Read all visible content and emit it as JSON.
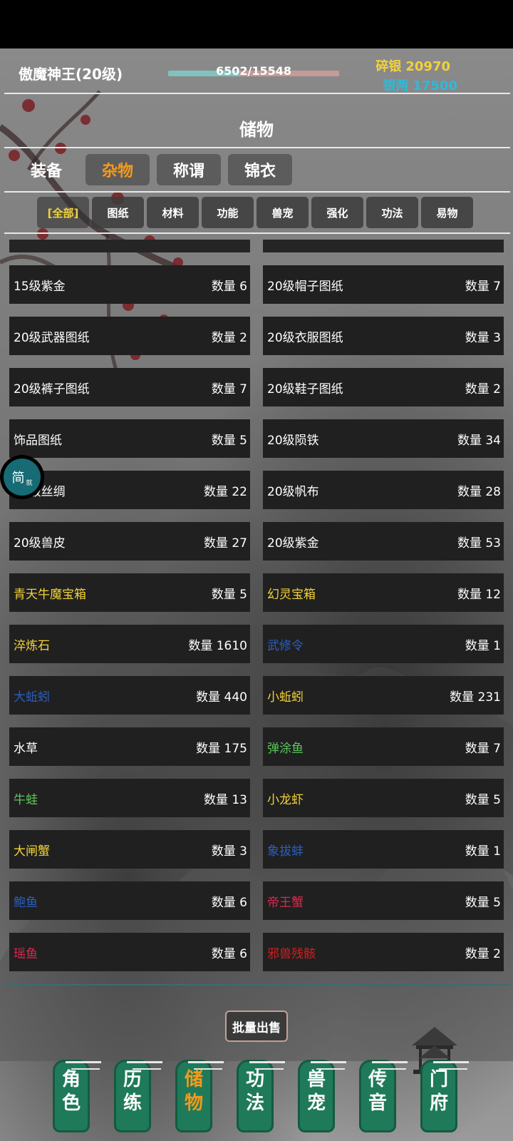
{
  "header": {
    "player_name": "傲魔神王(20级)",
    "hp_text": "6502/15548",
    "hp_current": 6502,
    "hp_max": 15548,
    "suiyin_label": "碎银",
    "suiyin_value": "20970",
    "yinliang_label": "银两",
    "yinliang_value": "17500"
  },
  "title": "储物",
  "tabs": [
    {
      "label": "装备",
      "active": false
    },
    {
      "label": "杂物",
      "active": true
    },
    {
      "label": "称谓",
      "active": false
    },
    {
      "label": "锦衣",
      "active": false
    }
  ],
  "subtabs": [
    {
      "label": "[全部]",
      "active": true
    },
    {
      "label": "图纸"
    },
    {
      "label": "材料"
    },
    {
      "label": "功能"
    },
    {
      "label": "兽宠"
    },
    {
      "label": "强化"
    },
    {
      "label": "功法"
    },
    {
      "label": "易物"
    }
  ],
  "items": [
    {
      "name": "15级紫金",
      "qty": "数量 6",
      "color": "white"
    },
    {
      "name": "20级帽子图纸",
      "qty": "数量 7",
      "color": "white"
    },
    {
      "name": "20级武器图纸",
      "qty": "数量 2",
      "color": "white"
    },
    {
      "name": "20级衣服图纸",
      "qty": "数量 3",
      "color": "white"
    },
    {
      "name": "20级裤子图纸",
      "qty": "数量 7",
      "color": "white"
    },
    {
      "name": "20级鞋子图纸",
      "qty": "数量 2",
      "color": "white"
    },
    {
      "name": "饰品图纸",
      "qty": "数量 5",
      "color": "white"
    },
    {
      "name": "20级陨铁",
      "qty": "数量 34",
      "color": "white"
    },
    {
      "name": "20级丝绸",
      "qty": "数量 22",
      "color": "white"
    },
    {
      "name": "20级帆布",
      "qty": "数量 28",
      "color": "white"
    },
    {
      "name": "20级兽皮",
      "qty": "数量 27",
      "color": "white"
    },
    {
      "name": "20级紫金",
      "qty": "数量 53",
      "color": "white"
    },
    {
      "name": "青天牛魔宝箱",
      "qty": "数量 5",
      "color": "yellow"
    },
    {
      "name": "幻灵宝箱",
      "qty": "数量 12",
      "color": "yellow"
    },
    {
      "name": "淬炼石",
      "qty": "数量 1610",
      "color": "yellow"
    },
    {
      "name": "武修令",
      "qty": "数量 1",
      "color": "blue"
    },
    {
      "name": "大蚯蚓",
      "qty": "数量 440",
      "color": "blue"
    },
    {
      "name": "小蚯蚓",
      "qty": "数量 231",
      "color": "yellow"
    },
    {
      "name": "水草",
      "qty": "数量 175",
      "color": "white"
    },
    {
      "name": "弹涂鱼",
      "qty": "数量 7",
      "color": "green"
    },
    {
      "name": "牛蛙",
      "qty": "数量 13",
      "color": "green"
    },
    {
      "name": "小龙虾",
      "qty": "数量 5",
      "color": "yellow"
    },
    {
      "name": "大闸蟹",
      "qty": "数量 3",
      "color": "yellow"
    },
    {
      "name": "象拔蚌",
      "qty": "数量 1",
      "color": "blue"
    },
    {
      "name": "鲍鱼",
      "qty": "数量 6",
      "color": "blue"
    },
    {
      "name": "帝王蟹",
      "qty": "数量 5",
      "color": "red"
    },
    {
      "name": "瑶鱼",
      "qty": "数量 6",
      "color": "red"
    },
    {
      "name": "邪兽残骸",
      "qty": "数量 2",
      "color": "crimson"
    }
  ],
  "batch_sell_label": "批量出售",
  "float_button": {
    "label": "简",
    "sub": "就"
  },
  "nav": [
    {
      "label": "角色",
      "active": false
    },
    {
      "label": "历练",
      "active": false
    },
    {
      "label": "储物",
      "active": true
    },
    {
      "label": "功法",
      "active": false
    },
    {
      "label": "兽宠",
      "active": false
    },
    {
      "label": "传音",
      "active": false
    },
    {
      "label": "门府",
      "active": false
    }
  ],
  "colors": {
    "accent_orange": "#f39a1c",
    "yellow": "#f2d23a",
    "cyan": "#2fb9d8",
    "nav_green": "#1f7a5a"
  }
}
